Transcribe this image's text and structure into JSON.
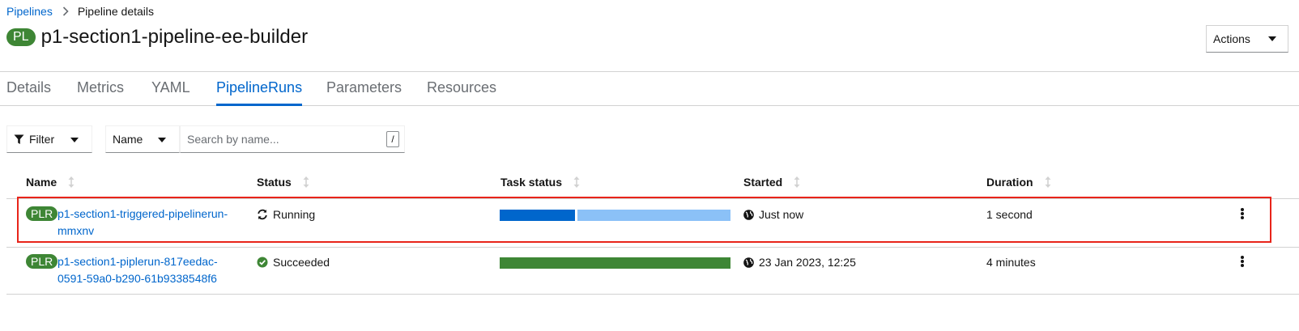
{
  "breadcrumb": {
    "root": "Pipelines",
    "current": "Pipeline details"
  },
  "header": {
    "badge": "PL",
    "title": "p1-section1-pipeline-ee-builder",
    "actions_label": "Actions"
  },
  "tabs": [
    "Details",
    "Metrics",
    "YAML",
    "PipelineRuns",
    "Parameters",
    "Resources"
  ],
  "active_tab": "PipelineRuns",
  "toolbar": {
    "filter_label": "Filter",
    "name_select": "Name",
    "search_placeholder": "Search by name...",
    "shortcut": "/"
  },
  "table": {
    "headers": [
      "Name",
      "Status",
      "Task status",
      "Started",
      "Duration"
    ],
    "rows": [
      {
        "badge": "PLR",
        "name_line1": "p1-section1-triggered-pipelinerun-",
        "name_line2": "mmxnv",
        "status": "Running",
        "status_icon": "sync-icon",
        "started": "Just now",
        "duration": "1 second",
        "task_progress": {
          "completed_fraction": 0.33,
          "colors": [
            "#0066cc",
            "#8bc1f7"
          ]
        }
      },
      {
        "badge": "PLR",
        "name_line1": "p1-section1-piplerun-817eedac-",
        "name_line2": "0591-59a0-b290-61b9338548f6",
        "status": "Succeeded",
        "status_icon": "check-circle-icon",
        "started": "23 Jan 2023, 12:25",
        "duration": "4 minutes",
        "task_progress": {
          "completed_fraction": 1.0,
          "colors": [
            "#3e8635"
          ]
        }
      }
    ]
  },
  "colors": {
    "link": "#0066cc",
    "success": "#3e8635",
    "running": "#0066cc",
    "running_pending": "#8bc1f7",
    "highlight": "#e8241a"
  }
}
